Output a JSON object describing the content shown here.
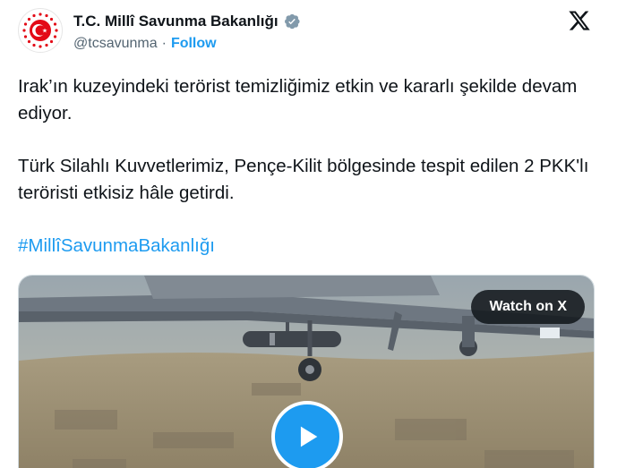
{
  "header": {
    "display_name": "T.C. Millî Savunma Bakanlığı",
    "handle": "@tcsavunma",
    "separator": "·",
    "follow_label": "Follow"
  },
  "tweet": {
    "paragraphs": [
      "Irak’ın kuzeyindeki terörist temizliğimiz etkin ve kararlı şekilde devam ediyor.",
      "Türk Silahlı Kuvvetlerimiz, Pençe-Kilit bölgesinde tespit edilen 2 PKK'lı teröristi etkisiz hâle getirdi."
    ],
    "hashtag": "#MillîSavunmaBakanlığı"
  },
  "media": {
    "watch_label": "Watch on X"
  },
  "colors": {
    "accent": "#1d9bf0",
    "text": "#0f1419",
    "secondary": "#536471",
    "logo_red": "#e30a17"
  },
  "icons": [
    "ministry-logo-icon",
    "verified-badge-icon",
    "x-logo-icon",
    "play-icon"
  ]
}
